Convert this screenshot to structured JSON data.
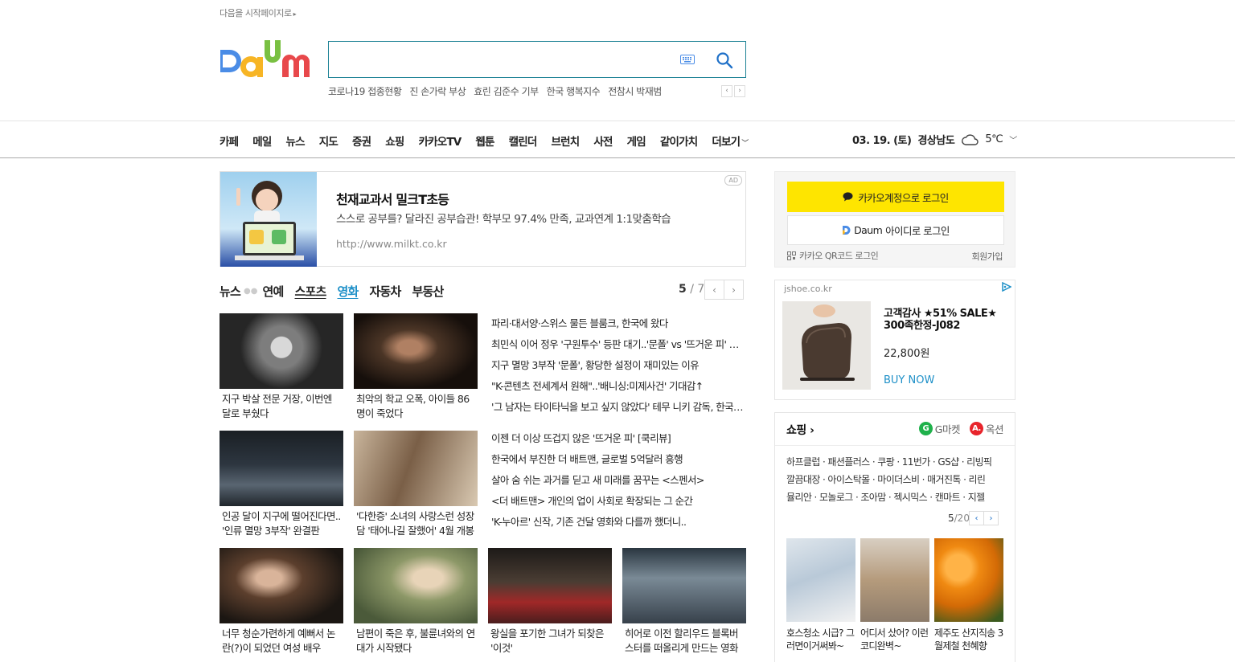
{
  "top": {
    "start_page_link": "다음을 시작페이지로"
  },
  "search": {
    "placeholder": "",
    "value": ""
  },
  "trends": [
    "코로나19 접종현황",
    "진 손가락 부상",
    "효린 김준수 기부",
    "한국 행복지수",
    "전참시 박재범"
  ],
  "gnb": {
    "items": [
      "카페",
      "메일",
      "뉴스",
      "지도",
      "증권",
      "쇼핑",
      "카카오TV",
      "웹툰",
      "캘린더",
      "브런치",
      "사전",
      "게임",
      "같이가치"
    ],
    "more": "더보기"
  },
  "weather": {
    "date": "03. 19. (토)",
    "region": "경상남도",
    "temp": "5℃"
  },
  "ad": {
    "title": "천재교과서 밀크T초등",
    "desc": "스스로 공부를? 달라진 공부습관! 학부모 97.4% 만족, 교과연계 1:1맞춤학습",
    "url": "http://www.milkt.co.kr",
    "badge": "AD"
  },
  "news": {
    "tabs": [
      "뉴스",
      "연예",
      "스포츠",
      "영화",
      "자동차",
      "부동산"
    ],
    "active_tab": "영화",
    "page_current": "5",
    "page_total": "/ 7",
    "cards_row1": [
      {
        "caption": "지구 박살 전문 거장, 이번엔 달로 부쉈다"
      },
      {
        "caption": "최악의 학교 오폭, 아이들 86명이 죽었다"
      }
    ],
    "headlines1": [
      "파리·대서양·스위스 물든 블룸크, 한국에 왔다",
      "최민식 이어 정우 '구원투수' 등판 대기..'문폴' vs '뜨거운 피' 맞대결",
      "지구 멸망 3부작 '문폴', 황당한 설정이 재미있는 이유",
      "\"K-콘텐츠 전세계서 원해\"..'배니싱:미제사건' 기대감↑",
      "'그 남자는 타이타닉을 보고 싶지 않았다' 테무 니키 감독, 한국 방문"
    ],
    "cards_row2": [
      {
        "caption": "인공 달이 지구에 떨어진다면.. '인류 멸망 3부작' 완결판"
      },
      {
        "caption": "'다한증' 소녀의 사랑스런 성장담 '태어나길 잘했어' 4월 개봉"
      }
    ],
    "headlines2": [
      "이젠 더 이상 뜨겁지 않은 '뜨거운 피' [쿡리뷰]",
      "한국에서 부진한 더 배트맨, 글로벌 5억달러 흥행",
      "살아 숨 쉬는 과거를 딛고 새 미래를 꿈꾸는 <스펜서>",
      "<더 배트맨> 개인의 업이 사회로 확장되는 그 순간",
      "'K-누아르' 신작, 기존 건달 영화와 다를까 했더니.."
    ],
    "cards_row3": [
      {
        "caption": "너무 청순가련하게 예뻐서 논란(?)이 되었던 여성 배우"
      },
      {
        "caption": "남편이 죽은 후, 불륜녀와의 연대가 시작됐다"
      },
      {
        "caption": "왕실을 포기한 그녀가 되찾은 '이것'"
      },
      {
        "caption": "히어로 이전 할리우드 블록버스터를 떠올리게 만드는 영화"
      }
    ]
  },
  "login": {
    "kakao": "카카오계정으로 로그인",
    "daum_brand": "Daum",
    "daum": "아이디로 로그인",
    "qr": "카카오 QR코드 로그인",
    "signup": "회원가입"
  },
  "side_ad": {
    "domain": "jshoe.co.kr",
    "title": "고객감사 ★51% SALE★ 300족한정-J082",
    "price": "22,800원",
    "buy": "BUY NOW"
  },
  "shopping": {
    "title": "쇼핑",
    "partners": [
      "G마켓",
      "옥션"
    ],
    "links": [
      "하프클럽 · 패션플러스 · 쿠팡 · 11번가 · GS샵 · 리빙픽",
      "깔끔대장 · 아이스탁몰 · 마이더스비 · 매거진톡 · 리린",
      "뮬리안 · 모놀로그 · 조아맘 · 젝시믹스 · 캔마트 · 지젤"
    ],
    "page_current": "5",
    "page_total": "/20",
    "items": [
      {
        "caption": "호스청소 시급? 그러면이거써봐~"
      },
      {
        "caption": "어디서 샀어? 이런코디완벽~"
      },
      {
        "caption": "제주도 산지직송 3월제철 천혜향"
      }
    ]
  }
}
